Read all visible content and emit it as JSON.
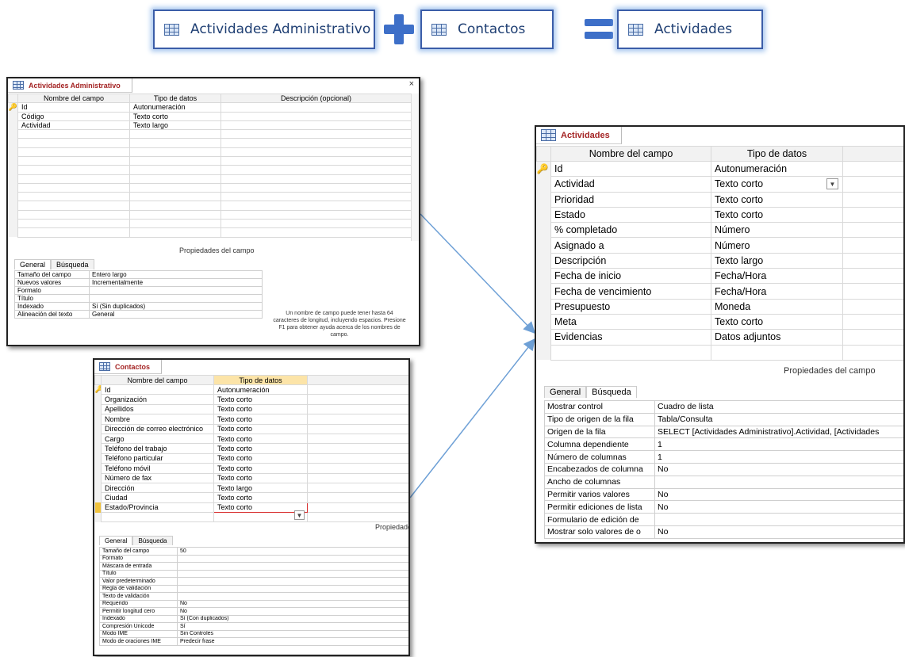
{
  "header": {
    "box1": "Actividades Administrativo",
    "box2": "Contactos",
    "box3": "Actividades"
  },
  "icons": {
    "table": "table-icon",
    "plus": "plus-icon",
    "equals": "equals-icon",
    "key": "primary-key-icon",
    "close": "close-icon",
    "dropdown": "chevron-down-icon"
  },
  "colors": {
    "accent": "#3d6fc8",
    "tab_title": "#a42424",
    "key": "#c9a227"
  },
  "admin": {
    "title": "Actividades Administrativo",
    "close": "×",
    "headers": [
      "Nombre del campo",
      "Tipo de datos",
      "Descripción (opcional)"
    ],
    "rows": [
      {
        "name": "Id",
        "type": "Autonumeración"
      },
      {
        "name": "Código",
        "type": "Texto corto"
      },
      {
        "name": "Actividad",
        "type": "Texto largo"
      }
    ],
    "props_title": "Propiedades del campo",
    "tabs": [
      "General",
      "Búsqueda"
    ],
    "props": [
      [
        "Tamaño del campo",
        "Entero largo"
      ],
      [
        "Nuevos valores",
        "Incrementalmente"
      ],
      [
        "Formato",
        ""
      ],
      [
        "Título",
        ""
      ],
      [
        "Indexado",
        "Sí (Sin duplicados)"
      ],
      [
        "Alineación del texto",
        "General"
      ]
    ],
    "help": "Un nombre de campo puede tener hasta 64 caracteres de longitud, incluyendo espacios. Presione F1 para obtener ayuda acerca de los nombres de campo."
  },
  "contactos": {
    "title": "Contactos",
    "headers": [
      "Nombre del campo",
      "Tipo de datos"
    ],
    "rows": [
      {
        "name": "Id",
        "type": "Autonumeración"
      },
      {
        "name": "Organización",
        "type": "Texto corto"
      },
      {
        "name": "Apellidos",
        "type": "Texto corto"
      },
      {
        "name": "Nombre",
        "type": "Texto corto"
      },
      {
        "name": "Dirección de correo electrónico",
        "type": "Texto corto"
      },
      {
        "name": "Cargo",
        "type": "Texto corto"
      },
      {
        "name": "Teléfono del trabajo",
        "type": "Texto corto"
      },
      {
        "name": "Teléfono particular",
        "type": "Texto corto"
      },
      {
        "name": "Teléfono móvil",
        "type": "Texto corto"
      },
      {
        "name": "Número de fax",
        "type": "Texto corto"
      },
      {
        "name": "Dirección",
        "type": "Texto largo"
      },
      {
        "name": "Ciudad",
        "type": "Texto corto"
      },
      {
        "name": "Estado/Provincia",
        "type": "Texto corto"
      }
    ],
    "props_title": "Propiedade",
    "tabs": [
      "General",
      "Búsqueda"
    ],
    "props": [
      [
        "Tamaño del campo",
        "50"
      ],
      [
        "Formato",
        ""
      ],
      [
        "Máscara de entrada",
        ""
      ],
      [
        "Título",
        ""
      ],
      [
        "Valor predeterminado",
        ""
      ],
      [
        "Regla de validación",
        ""
      ],
      [
        "Texto de validación",
        ""
      ],
      [
        "Requerido",
        "No"
      ],
      [
        "Permitir longitud cero",
        "No"
      ],
      [
        "Indexado",
        "Sí (Con duplicados)"
      ],
      [
        "Compresión Unicode",
        "Sí"
      ],
      [
        "Modo IME",
        "Sin Controles"
      ],
      [
        "Modo de oraciones IME",
        "Predecir frase"
      ]
    ]
  },
  "actividades": {
    "title": "Actividades",
    "headers": [
      "Nombre del campo",
      "Tipo de datos"
    ],
    "rows": [
      {
        "name": "Id",
        "type": "Autonumeración"
      },
      {
        "name": "Actividad",
        "type": "Texto corto"
      },
      {
        "name": "Prioridad",
        "type": "Texto corto"
      },
      {
        "name": "Estado",
        "type": "Texto corto"
      },
      {
        "name": "% completado",
        "type": "Número"
      },
      {
        "name": "Asignado a",
        "type": "Número"
      },
      {
        "name": "Descripción",
        "type": "Texto largo"
      },
      {
        "name": "Fecha de inicio",
        "type": "Fecha/Hora"
      },
      {
        "name": "Fecha de vencimiento",
        "type": "Fecha/Hora"
      },
      {
        "name": "Presupuesto",
        "type": "Moneda"
      },
      {
        "name": "Meta",
        "type": "Texto corto"
      },
      {
        "name": "Evidencias",
        "type": "Datos adjuntos"
      }
    ],
    "props_title": "Propiedades del campo",
    "tabs": [
      "General",
      "Búsqueda"
    ],
    "props": [
      [
        "Mostrar control",
        "Cuadro de lista"
      ],
      [
        "Tipo de origen de la fila",
        "Tabla/Consulta"
      ],
      [
        "Origen de la fila",
        "SELECT [Actividades Administrativo].Actividad, [Actividades"
      ],
      [
        "Columna dependiente",
        "1"
      ],
      [
        "Número de columnas",
        "1"
      ],
      [
        "Encabezados de columna",
        "No"
      ],
      [
        "Ancho de columnas",
        ""
      ],
      [
        "Permitir varios valores",
        "No"
      ],
      [
        "Permitir ediciones de lista",
        "No"
      ],
      [
        "Formulario de edición de",
        ""
      ],
      [
        "Mostrar solo valores de o",
        "No"
      ]
    ]
  }
}
